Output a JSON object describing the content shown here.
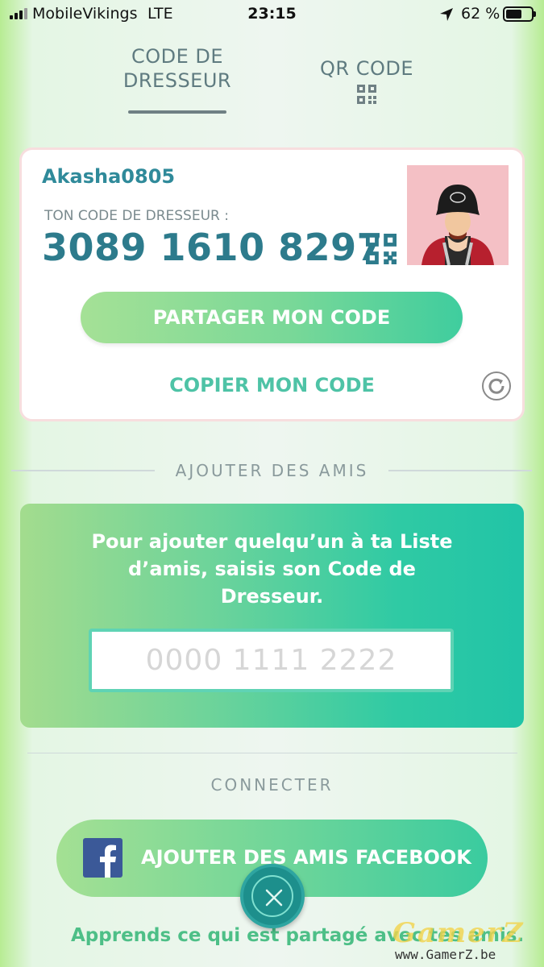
{
  "status_bar": {
    "carrier": "MobileVikings",
    "network": "LTE",
    "time": "23:15",
    "battery_percent": "62 %",
    "battery_level": 0.62,
    "location_icon": "location-arrow-icon"
  },
  "tabs": [
    {
      "label_line1": "CODE DE",
      "label_line2": "DRESSEUR",
      "active": true
    },
    {
      "label": "QR CODE",
      "icon": "qr-code-icon",
      "active": false
    }
  ],
  "trainer_card": {
    "username": "Akasha0805",
    "code_label": "TON CODE DE DRESSEUR :",
    "code": "3089 1610 8297",
    "share_button": "PARTAGER MON CODE",
    "copy_link": "COPIER MON CODE"
  },
  "add_friends": {
    "heading": "AJOUTER DES AMIS",
    "instructions": "Pour ajouter quelqu’un à ta Liste d’amis, saisis son Code de Dresseur.",
    "input_placeholder": "0000 1111 2222"
  },
  "connect": {
    "heading": "CONNECTER",
    "facebook_button": "AJOUTER DES AMIS FACEBOOK",
    "learn_link": "Apprends ce qui est partagé avec tes amis."
  },
  "watermark": {
    "logo": "GamerZ",
    "url": "www.GamerZ.be"
  },
  "colors": {
    "accent_teal": "#2d7b8c",
    "green_button": "#79d898",
    "facebook_blue": "#3b5998"
  }
}
